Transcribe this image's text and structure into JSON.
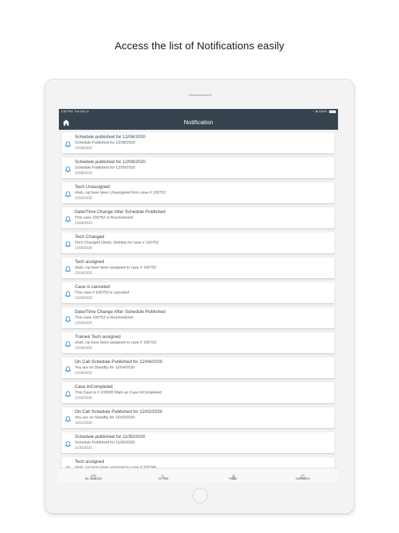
{
  "caption": "Access the list of Notifications easily",
  "status_bar": {
    "time": "4:02 PM",
    "day": "Tue Dec 8",
    "battery": "100%"
  },
  "nav": {
    "title": "Notification"
  },
  "notifications": [
    {
      "title": "Schedule published for 12/08/2020",
      "body": "Schedule Published for 12/08/2020",
      "date": "12/08/2020"
    },
    {
      "title": "Schedule published for 12/09/2020",
      "body": "Schedule Published for 12/09/2020",
      "date": "12/08/2020"
    },
    {
      "title": "Tech Unassigned",
      "body": "shah, raj have been Unassigned from case # 100752",
      "date": "12/04/2020"
    },
    {
      "title": "Date/Time Change After Schedule Published",
      "body": "This case 100752 is Rescheduled",
      "date": "12/04/2020"
    },
    {
      "title": "Tech Changed",
      "body": "Tech Changed (Shah, Dishita) for case # 100752",
      "date": "12/04/2020"
    },
    {
      "title": "Tech assigned",
      "body": "shah, raj have been assigned to case # 100752",
      "date": "12/04/2020"
    },
    {
      "title": "Case is canceled",
      "body": "This case # 100753 is canceled",
      "date": "12/04/2020"
    },
    {
      "title": "Date/Time Change After Schedule Published",
      "body": "This case 100753 is Rescheduled",
      "date": "12/04/2020"
    },
    {
      "title": "Traineé Tech assigned",
      "body": "shah, raj have been assigned to case # 100753",
      "date": "12/04/2020"
    },
    {
      "title": "On Call Schedule Published for 12/04/2020",
      "body": "You are on Standby for 12/04/2020",
      "date": "12/04/2020"
    },
    {
      "title": "Case InCompleted",
      "body": "This Case is # 100095 Mark as Case InCompleted",
      "date": "12/02/2020"
    },
    {
      "title": "On Call Schedule Published for 12/02/2020",
      "body": "You are on Standby for 12/02/2020",
      "date": "12/01/2020"
    },
    {
      "title": "Schedule published for 11/30/2020",
      "body": "Schedule Published for 11/30/2020",
      "date": "11/30/2020"
    },
    {
      "title": "Tech assigned",
      "body": "shah, raj have been assigned to case # 100745",
      "date": ""
    }
  ],
  "tabs": [
    {
      "label": "My Schedule",
      "icon": "calendar-icon"
    },
    {
      "label": "On Call",
      "icon": "phone-icon"
    },
    {
      "label": "Profile",
      "icon": "person-icon"
    },
    {
      "label": "Notification",
      "icon": "bell-icon",
      "active": true
    }
  ],
  "colors": {
    "header": "#37444f",
    "accent": "#2a87c9",
    "background": "#f0f1f3"
  }
}
